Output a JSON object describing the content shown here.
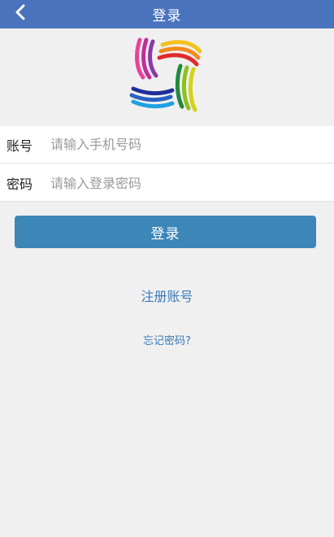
{
  "header": {
    "title": "登录",
    "back_icon": "chevron-left-icon"
  },
  "logo": {
    "icon": "woven-rainbow-logo"
  },
  "form": {
    "account_label": "账号",
    "account_placeholder": "请输入手机号码",
    "account_value": "",
    "password_label": "密码",
    "password_placeholder": "请输入登录密码",
    "password_value": ""
  },
  "actions": {
    "login_label": "登录",
    "register_label": "注册账号",
    "forgot_label": "忘记密码?"
  },
  "colors": {
    "header_bg": "#4a73bd",
    "button_bg": "#3c86b8",
    "link": "#3a7ab5",
    "page_bg": "#f0f0f0"
  }
}
